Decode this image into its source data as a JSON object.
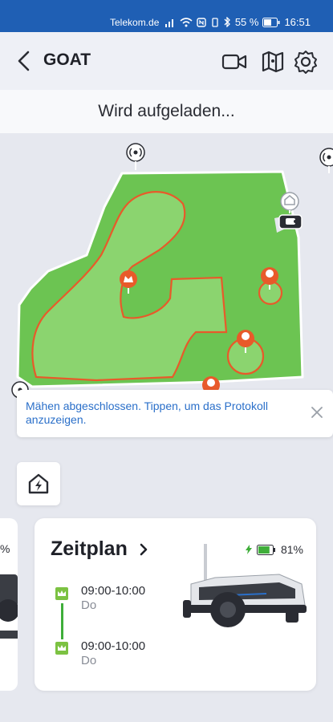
{
  "status_bar": {
    "carrier": "Telekom.de",
    "battery_percent": "55 %",
    "time": "16:51"
  },
  "header": {
    "title": "GOAT",
    "icons": [
      "back-arrow-icon",
      "video-camera-icon",
      "map-icon",
      "gear-icon"
    ]
  },
  "status_banner": {
    "text": "Wird aufgeladen..."
  },
  "toast": {
    "message": "Mähen abgeschlossen. Tippen, um das Protokoll anzuzeigen."
  },
  "schedule_card": {
    "title": "Zeitplan",
    "battery_percent": "81%",
    "battery_level": 0.81,
    "entries": [
      {
        "time": "09:00-10:00",
        "day": "Do"
      },
      {
        "time": "09:00-10:00",
        "day": "Do"
      }
    ]
  },
  "left_card": {
    "partial_text": "%"
  },
  "colors": {
    "status_bar": "#1f5fb4",
    "lawn": "#6cc452",
    "lawn_light": "#8bd46f",
    "zone_border": "#e85a2a",
    "accent_green": "#3fae3a",
    "link_blue": "#2a6fc9"
  }
}
